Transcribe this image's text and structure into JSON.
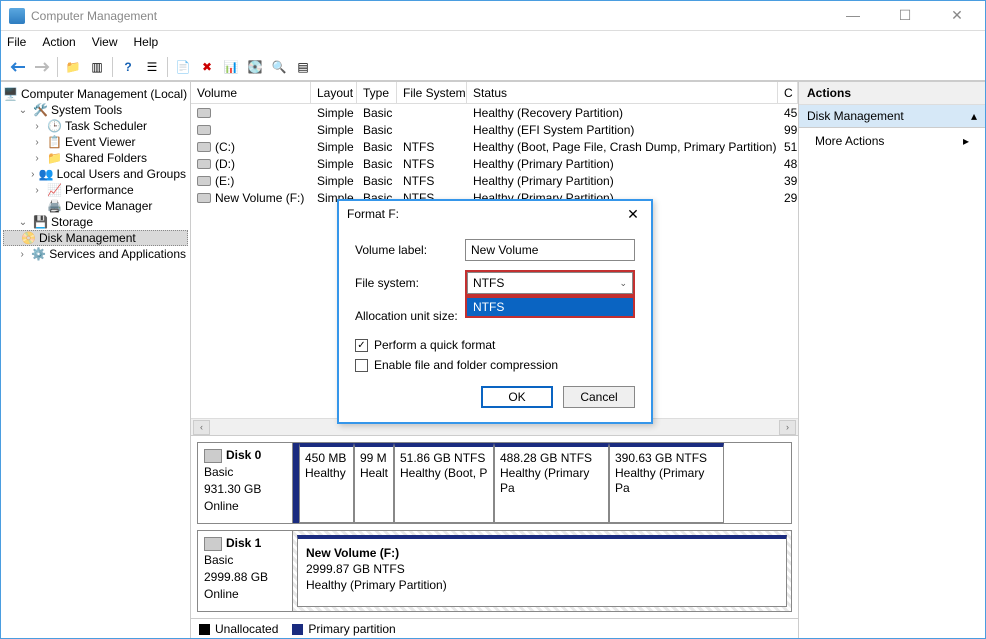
{
  "window_title": "Computer Management",
  "menubar": {
    "file": "File",
    "action": "Action",
    "view": "View",
    "help": "Help"
  },
  "tree": {
    "root": "Computer Management (Local)",
    "systools": "System Tools",
    "task": "Task Scheduler",
    "event": "Event Viewer",
    "shared": "Shared Folders",
    "users": "Local Users and Groups",
    "perf": "Performance",
    "devmgr": "Device Manager",
    "storage": "Storage",
    "diskmgmt": "Disk Management",
    "services": "Services and Applications"
  },
  "vol_headers": {
    "volume": "Volume",
    "layout": "Layout",
    "type": "Type",
    "fs": "File System",
    "status": "Status",
    "c": "C"
  },
  "volumes": [
    {
      "name": "",
      "layout": "Simple",
      "type": "Basic",
      "fs": "",
      "status": "Healthy (Recovery Partition)",
      "c": "45"
    },
    {
      "name": "",
      "layout": "Simple",
      "type": "Basic",
      "fs": "",
      "status": "Healthy (EFI System Partition)",
      "c": "99"
    },
    {
      "name": "(C:)",
      "layout": "Simple",
      "type": "Basic",
      "fs": "NTFS",
      "status": "Healthy (Boot, Page File, Crash Dump, Primary Partition)",
      "c": "51"
    },
    {
      "name": "(D:)",
      "layout": "Simple",
      "type": "Basic",
      "fs": "NTFS",
      "status": "Healthy (Primary Partition)",
      "c": "48"
    },
    {
      "name": "(E:)",
      "layout": "Simple",
      "type": "Basic",
      "fs": "NTFS",
      "status": "Healthy (Primary Partition)",
      "c": "39"
    },
    {
      "name": "New Volume (F:)",
      "layout": "Simple",
      "type": "Basic",
      "fs": "NTFS",
      "status": "Healthy (Primary Partition)",
      "c": "29"
    }
  ],
  "disk0": {
    "name": "Disk 0",
    "type": "Basic",
    "size": "931.30 GB",
    "state": "Online",
    "parts": [
      {
        "l1": "450 MB",
        "l2": "Healthy"
      },
      {
        "l1": "99 M",
        "l2": "Healt"
      },
      {
        "l1": "51.86 GB NTFS",
        "l2": "Healthy (Boot, P"
      },
      {
        "l1": "488.28 GB NTFS",
        "l2": "Healthy (Primary Pa"
      },
      {
        "l1": "390.63 GB NTFS",
        "l2": "Healthy (Primary Pa"
      }
    ]
  },
  "disk1": {
    "name": "Disk 1",
    "type": "Basic",
    "size": "2999.88 GB",
    "state": "Online",
    "vol": "New Volume  (F:)",
    "sz": "2999.87 GB NTFS",
    "st": "Healthy (Primary Partition)"
  },
  "legend": {
    "un": "Unallocated",
    "pp": "Primary partition"
  },
  "actions": {
    "header": "Actions",
    "group": "Disk Management",
    "more": "More Actions"
  },
  "dialog": {
    "title": "Format F:",
    "lbl_vol": "Volume label:",
    "val_vol": "New Volume",
    "lbl_fs": "File system:",
    "sel_fs": "NTFS",
    "opt_fs": "NTFS",
    "lbl_au": "Allocation unit size:",
    "chk_quick": "Perform a quick format",
    "chk_quick_checked": "✓",
    "chk_comp": "Enable file and folder compression",
    "ok": "OK",
    "cancel": "Cancel"
  }
}
